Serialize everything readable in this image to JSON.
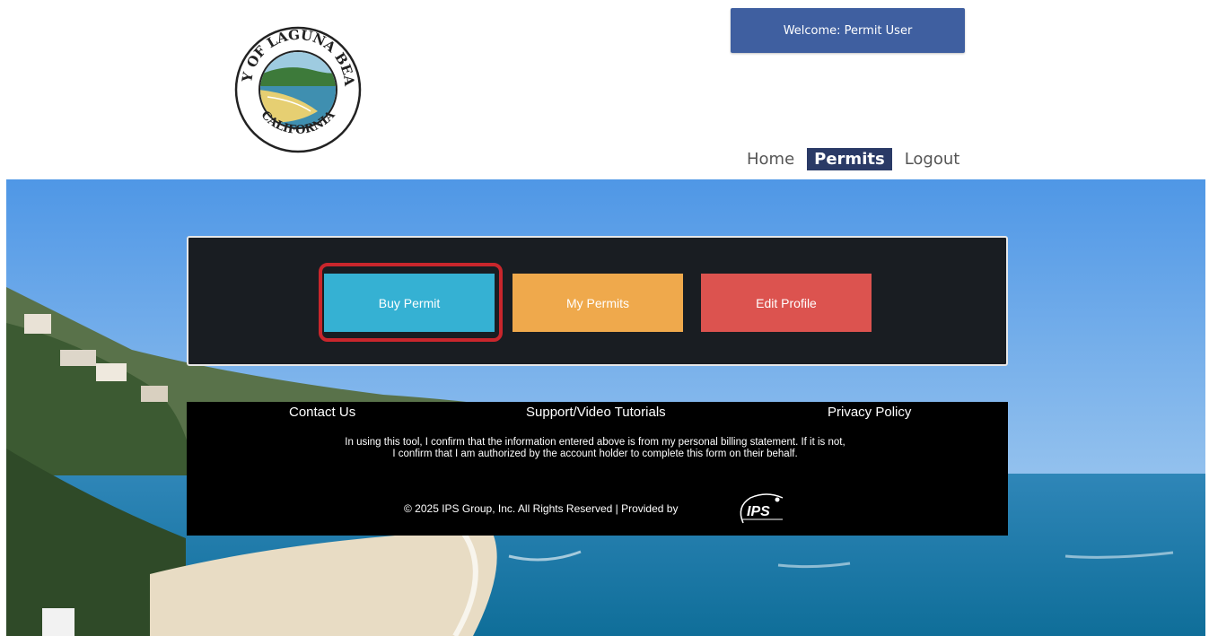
{
  "header": {
    "logo_top_text": "CITY OF LAGUNA BEACH",
    "logo_bottom_text": "CALIFORNIA",
    "welcome_text": "Welcome:  Permit User"
  },
  "nav": {
    "items": [
      {
        "label": "Home",
        "active": false
      },
      {
        "label": "Permits",
        "active": true
      },
      {
        "label": "Logout",
        "active": false
      }
    ]
  },
  "actions": {
    "buy_permit": "Buy Permit",
    "my_permits": "My Permits",
    "edit_profile": "Edit Profile"
  },
  "footer": {
    "contact": "Contact Us",
    "support": "Support/Video Tutorials",
    "privacy": "Privacy Policy",
    "disclaimer": "In using this tool, I confirm that the information entered above is from my personal billing statement. If it is not, I confirm that I am authorized by the account holder to complete this form on their behalf.",
    "copyright": "© 2025 IPS Group, Inc. All Rights Reserved  | Provided by",
    "provider_logo": "IPS"
  },
  "colors": {
    "welcome_bg": "#3f5fa0",
    "nav_active_bg": "#2a3a66",
    "buy_btn": "#35b1d3",
    "my_permits_btn": "#efa94c",
    "edit_profile_btn": "#dc534f",
    "highlight": "#c9262c"
  }
}
